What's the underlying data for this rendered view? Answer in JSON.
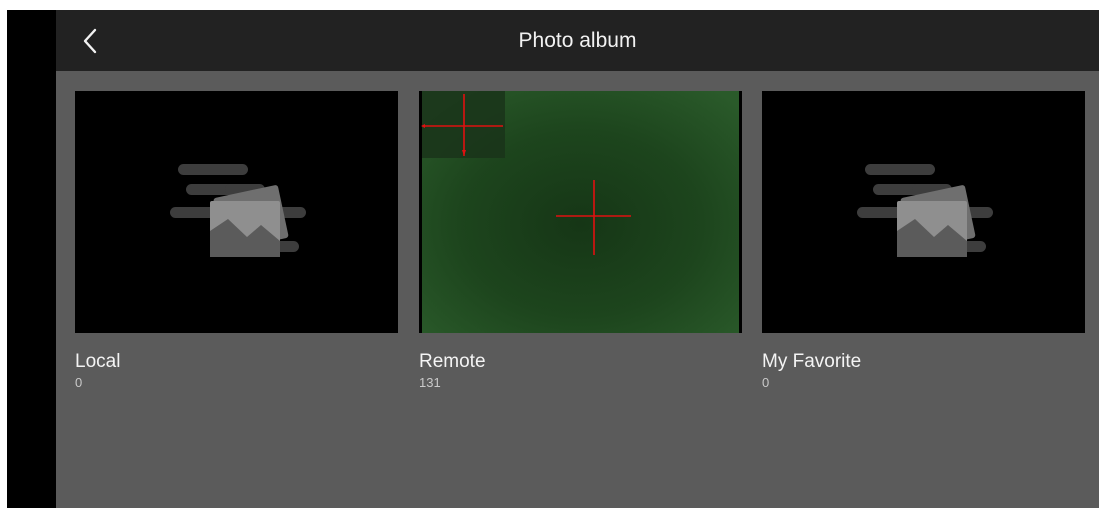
{
  "header": {
    "title": "Photo album",
    "back_icon": "chevron-left-icon"
  },
  "albums": [
    {
      "name": "Local",
      "count": "0",
      "thumbnail": "placeholder-image-icon"
    },
    {
      "name": "Remote",
      "count": "131",
      "thumbnail": "thermal-crosshair-preview"
    },
    {
      "name": "My Favorite",
      "count": "0",
      "thumbnail": "placeholder-image-icon"
    }
  ],
  "colors": {
    "topbar": "#222222",
    "background": "#5b5b5b",
    "crosshair": "#e01010",
    "preview_green": "#1f4a1f"
  }
}
